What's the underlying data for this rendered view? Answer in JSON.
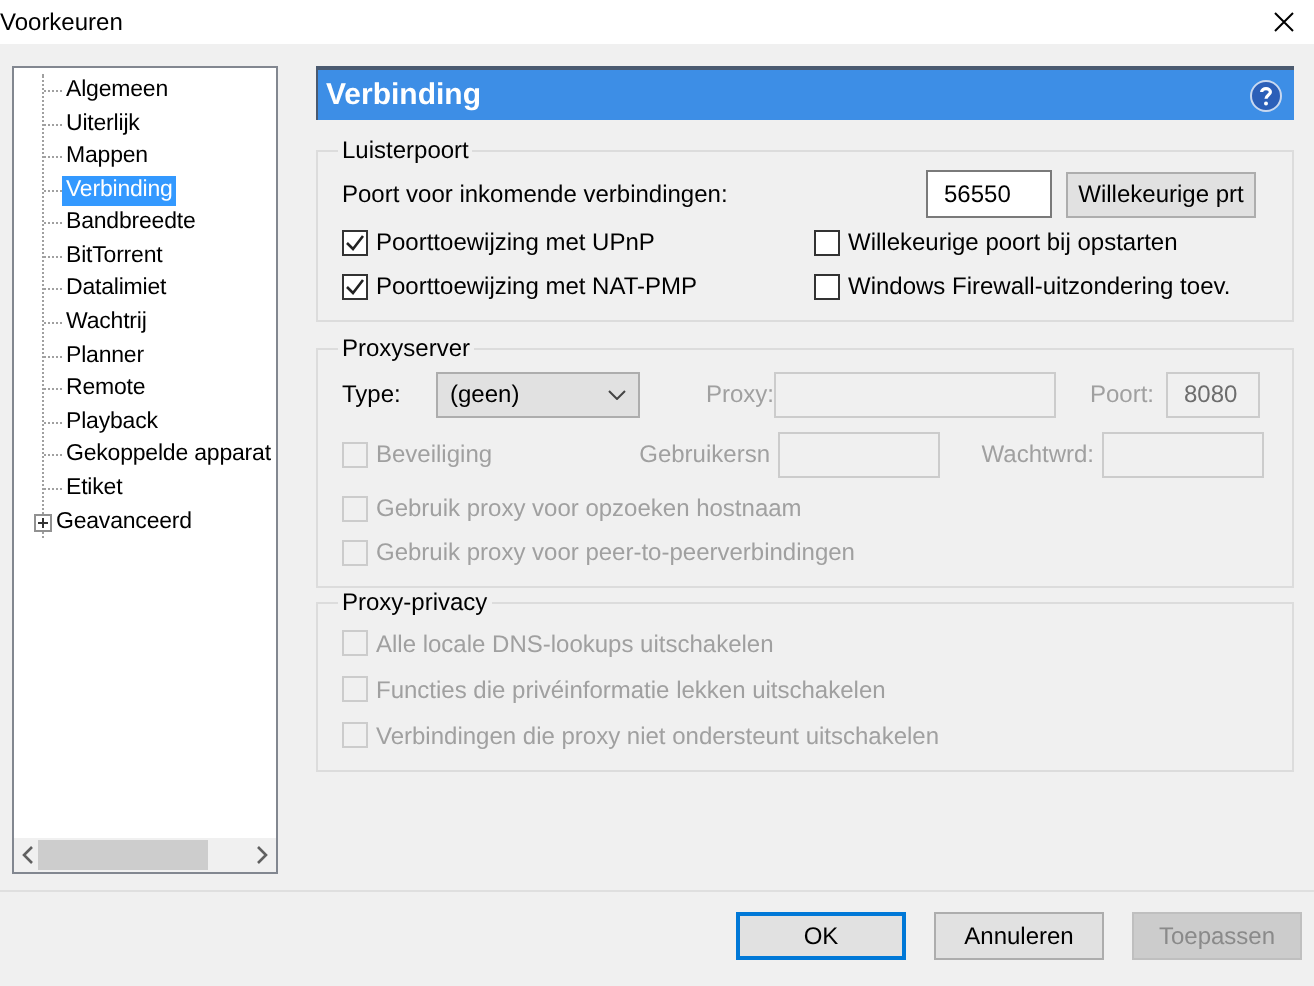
{
  "window": {
    "title": "Voorkeuren"
  },
  "sidebar": {
    "items": [
      {
        "label": "Algemeen",
        "selected": false
      },
      {
        "label": "Uiterlijk",
        "selected": false
      },
      {
        "label": "Mappen",
        "selected": false
      },
      {
        "label": "Verbinding",
        "selected": true
      },
      {
        "label": "Bandbreedte",
        "selected": false
      },
      {
        "label": "BitTorrent",
        "selected": false
      },
      {
        "label": "Datalimiet",
        "selected": false
      },
      {
        "label": "Wachtrij",
        "selected": false
      },
      {
        "label": "Planner",
        "selected": false
      },
      {
        "label": "Remote",
        "selected": false
      },
      {
        "label": "Playback",
        "selected": false
      },
      {
        "label": "Gekoppelde apparat",
        "selected": false
      },
      {
        "label": "Etiket",
        "selected": false
      },
      {
        "label": "Geavanceerd",
        "selected": false,
        "expanded": false
      }
    ]
  },
  "panel": {
    "title": "Verbinding"
  },
  "listening_port": {
    "title": "Luisterpoort",
    "port_label": "Poort voor inkomende verbindingen:",
    "port_value": "56550",
    "random_button": "Willekeurige prt",
    "options": [
      {
        "label": "Poorttoewijzing met UPnP",
        "checked": true
      },
      {
        "label": "Willekeurige poort bij opstarten",
        "checked": false
      },
      {
        "label": "Poorttoewijzing met NAT-PMP",
        "checked": true
      },
      {
        "label": "Windows Firewall-uitzondering toev.",
        "checked": false
      }
    ]
  },
  "proxy_server": {
    "title": "Proxyserver",
    "type_label": "Type:",
    "type_value": "(geen)",
    "proxy_label": "Proxy:",
    "port_label": "Poort:",
    "port_value": "8080",
    "fields_disabled": true,
    "auth": {
      "label": "Beveiliging",
      "checked": false,
      "disabled": true
    },
    "username_label": "Gebruikersn",
    "password_label": "Wachtwrd:",
    "options": [
      {
        "label": "Gebruik proxy voor opzoeken hostnaam",
        "checked": false,
        "disabled": true
      },
      {
        "label": "Gebruik proxy voor peer-to-peerverbindingen",
        "checked": false,
        "disabled": true
      }
    ]
  },
  "proxy_privacy": {
    "title": "Proxy-privacy",
    "options": [
      {
        "label": "Alle locale DNS-lookups uitschakelen",
        "checked": false,
        "disabled": true
      },
      {
        "label": "Functies die privéinformatie lekken uitschakelen",
        "checked": false,
        "disabled": true
      },
      {
        "label": "Verbindingen die proxy niet ondersteunt uitschakelen",
        "checked": false,
        "disabled": true
      }
    ]
  },
  "buttons": [
    {
      "label": "OK",
      "kind": "default"
    },
    {
      "label": "Annuleren",
      "kind": "normal"
    },
    {
      "label": "Toepassen",
      "kind": "disabled"
    }
  ]
}
